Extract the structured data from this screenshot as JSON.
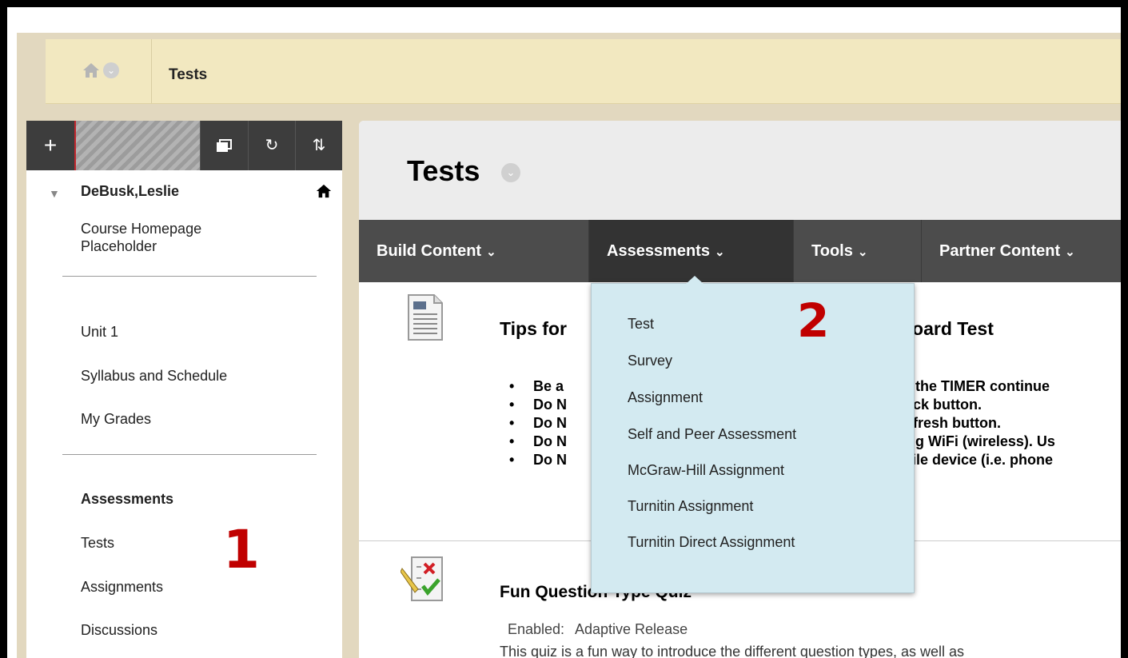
{
  "breadcrumb": {
    "title": "Tests"
  },
  "left_menu": {
    "user_name": "DeBusk,Leslie",
    "course_home": [
      "Course Homepage",
      "Placeholder"
    ],
    "group1": [
      "Unit 1",
      "Syllabus and Schedule",
      "My Grades"
    ],
    "section_heading": "Assessments",
    "group2": [
      "Tests",
      "Assignments",
      "Discussions"
    ]
  },
  "page": {
    "title": "Tests",
    "tabs": [
      {
        "label": "Build Content"
      },
      {
        "label": "Assessments"
      },
      {
        "label": "Tools"
      },
      {
        "label": "Partner Content"
      }
    ]
  },
  "items": [
    {
      "title_left": "Tips for",
      "title_right": "board Test",
      "bullet_lead": [
        "Be a",
        "Do N",
        "Do N",
        "Do N",
        "Do N"
      ],
      "bullet_tail": [
        "er, the TIMER continue",
        "Back button.",
        "Refresh button.",
        "sing WiFi (wireless). Us",
        "obile device (i.e. phone"
      ]
    },
    {
      "title": "Fun Question Type Quiz",
      "meta_label": "Enabled:",
      "meta_value": "Adaptive Release",
      "description": "This quiz is a fun way to introduce the different question types, as well as"
    }
  ],
  "assessments_menu": [
    "Test",
    "Survey",
    "Assignment",
    "Self and Peer Assessment",
    "McGraw-Hill Assignment",
    "Turnitin Assignment",
    "Turnitin Direct Assignment"
  ],
  "annotations": [
    "1",
    "2"
  ],
  "colors": {
    "annotation": "#c00000",
    "menu_bg": "#d3eaf1",
    "action_bar": "#4c4c4c"
  }
}
